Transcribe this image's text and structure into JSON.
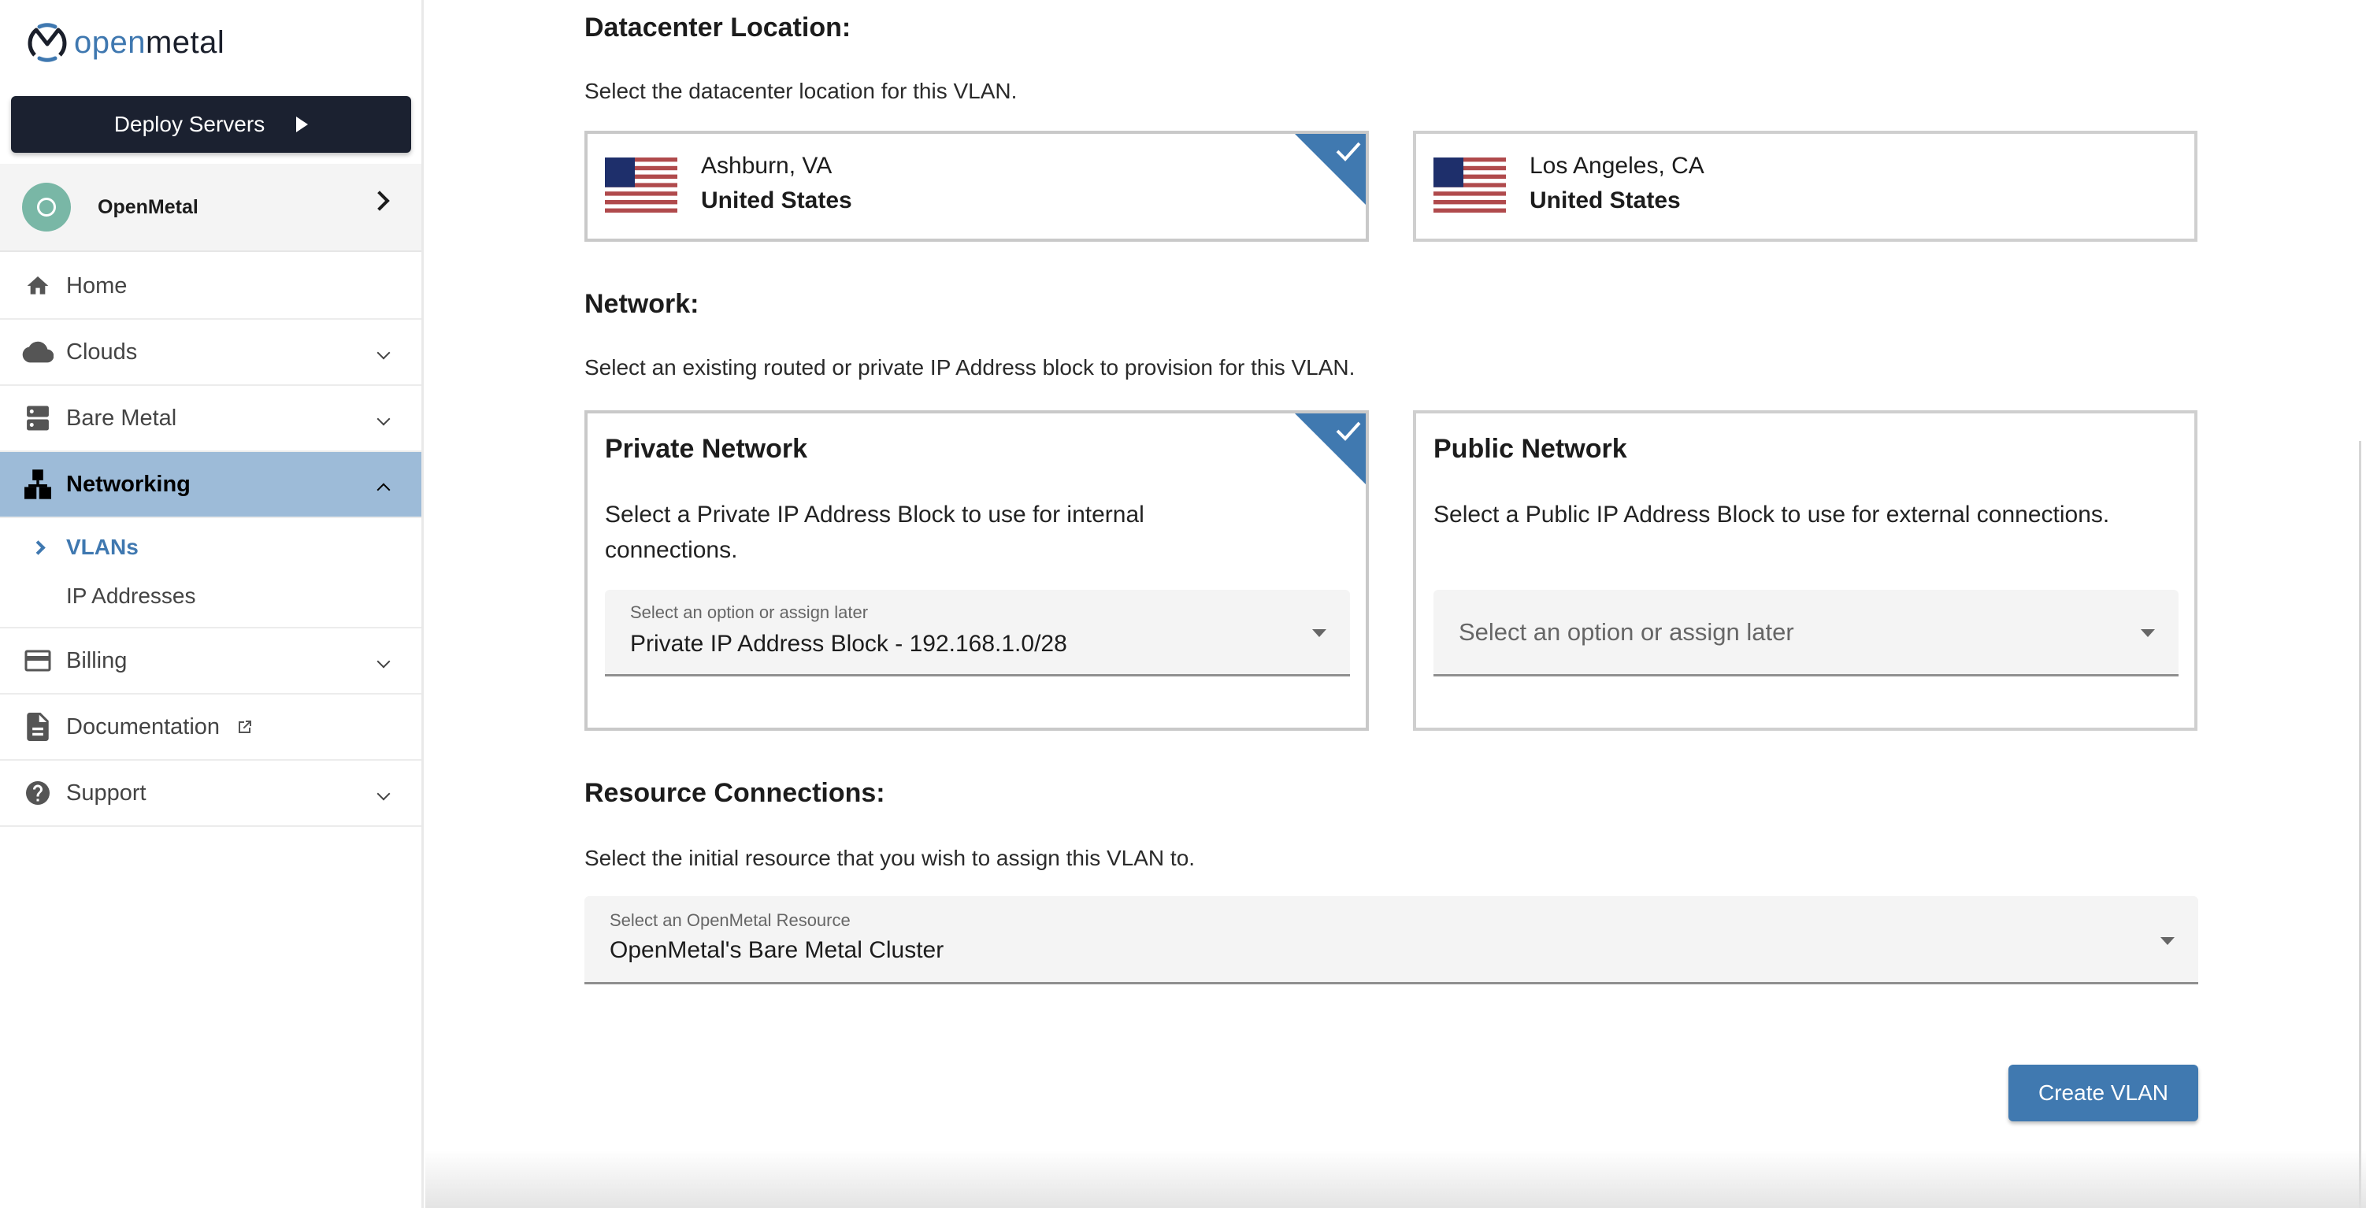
{
  "brand": {
    "logo_open": "open",
    "logo_metal": "metal",
    "accent": "#3f78b0",
    "dark": "#1b2130"
  },
  "sidebar": {
    "deploy_label": "Deploy Servers",
    "org_initial": "O",
    "org_name": "OpenMetal",
    "items": [
      {
        "label": "Home",
        "icon": "home-icon",
        "expandable": false
      },
      {
        "label": "Clouds",
        "icon": "cloud-icon",
        "expandable": true
      },
      {
        "label": "Bare Metal",
        "icon": "server-icon",
        "expandable": true
      },
      {
        "label": "Networking",
        "icon": "network-icon",
        "expandable": true,
        "expanded": true,
        "active": true,
        "children": [
          {
            "label": "VLANs",
            "active": true
          },
          {
            "label": "IP Addresses",
            "active": false
          }
        ]
      },
      {
        "label": "Billing",
        "icon": "credit-card-icon",
        "expandable": true
      },
      {
        "label": "Documentation",
        "icon": "document-icon",
        "external": true
      },
      {
        "label": "Support",
        "icon": "help-icon",
        "expandable": true
      }
    ]
  },
  "form": {
    "datacenter": {
      "heading": "Datacenter Location:",
      "description": "Select the datacenter location for this VLAN.",
      "options": [
        {
          "city": "Ashburn, VA",
          "country": "United States",
          "flag": "us-flag-icon",
          "selected": true
        },
        {
          "city": "Los Angeles, CA",
          "country": "United States",
          "flag": "us-flag-icon",
          "selected": false
        }
      ]
    },
    "network": {
      "heading": "Network:",
      "description": "Select an existing routed or private IP Address block to provision for this VLAN.",
      "private": {
        "title": "Private Network",
        "description": "Select a Private IP Address Block to use for internal connections.",
        "select_label": "Select an option or assign later",
        "select_value": "Private IP Address Block - 192.168.1.0/28",
        "selected": true
      },
      "public": {
        "title": "Public Network",
        "description": "Select a Public IP Address Block to use for external connections.",
        "select_placeholder": "Select an option or assign later",
        "select_value": "",
        "selected": false
      }
    },
    "resource": {
      "heading": "Resource Connections:",
      "description": "Select the initial resource that you wish to assign this VLAN to.",
      "select_label": "Select an OpenMetal Resource",
      "select_value": "OpenMetal's Bare Metal Cluster"
    },
    "submit_label": "Create VLAN"
  }
}
